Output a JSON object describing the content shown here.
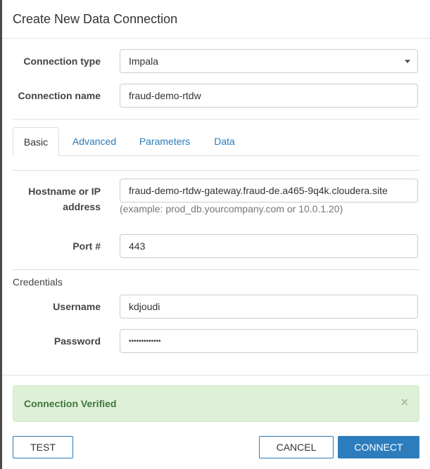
{
  "dialog": {
    "title": "Create New Data Connection"
  },
  "form": {
    "connection_type": {
      "label": "Connection type",
      "value": "Impala"
    },
    "connection_name": {
      "label": "Connection name",
      "value": "fraud-demo-rtdw"
    }
  },
  "tabs": [
    {
      "label": "Basic",
      "active": true
    },
    {
      "label": "Advanced",
      "active": false
    },
    {
      "label": "Parameters",
      "active": false
    },
    {
      "label": "Data",
      "active": false
    }
  ],
  "basic": {
    "hostname": {
      "label_line1": "Hostname or IP",
      "label_line2": "address",
      "value": "fraud-demo-rtdw-gateway.fraud-de.a465-9q4k.cloudera.site",
      "help": "(example: prod_db.yourcompany.com or 10.0.1.20)"
    },
    "port": {
      "label": "Port #",
      "value": "443"
    }
  },
  "credentials": {
    "title": "Credentials",
    "username": {
      "label": "Username",
      "value": "kdjoudi"
    },
    "password": {
      "label": "Password",
      "value": "•••••••••••••"
    }
  },
  "alert": {
    "message": "Connection Verified",
    "close_icon": "×",
    "color": "#3c763d",
    "background": "#dff0d8"
  },
  "buttons": {
    "test": "TEST",
    "cancel": "CANCEL",
    "connect": "CONNECT",
    "primary_color": "#2d7dbd"
  }
}
